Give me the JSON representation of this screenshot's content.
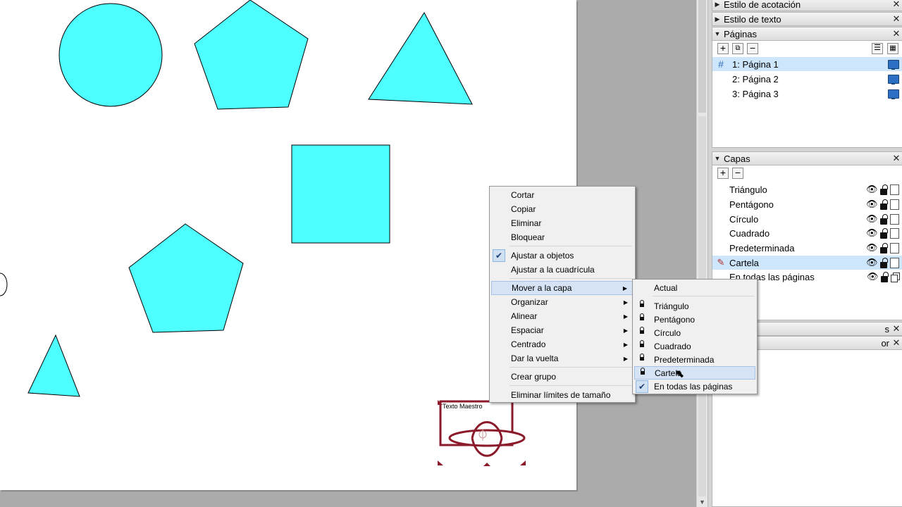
{
  "canvas": {
    "shape_fill": "#4dffff",
    "stamp_color": "#8b1a2b",
    "stamp_label": "Texto Maestro"
  },
  "panels": {
    "acotacion": {
      "title": "Estilo de acotación"
    },
    "texto": {
      "title": "Estilo de texto"
    },
    "paginas": {
      "title": "Páginas",
      "toolbar": [
        "add-icon",
        "duplicate-icon",
        "remove-icon",
        "list-view-icon",
        "grid-view-icon"
      ],
      "items": [
        {
          "label": "1:  Página 1",
          "selected": true
        },
        {
          "label": "2:  Página 2",
          "selected": false
        },
        {
          "label": "3:  Página 3",
          "selected": false
        }
      ]
    },
    "capas": {
      "title": "Capas",
      "items": [
        {
          "label": "Triángulo",
          "selected": false
        },
        {
          "label": "Pentágono",
          "selected": false
        },
        {
          "label": "Círculo",
          "selected": false
        },
        {
          "label": "Cuadrado",
          "selected": false
        },
        {
          "label": "Predeterminada",
          "selected": false
        },
        {
          "label": "Cartela",
          "selected": true
        },
        {
          "label": "En todas las páginas",
          "selected": false
        }
      ]
    },
    "collapsed1": {
      "title": "s"
    },
    "collapsed2": {
      "title": "or"
    }
  },
  "context_menu": {
    "items": [
      {
        "label": "Cortar"
      },
      {
        "label": "Copiar"
      },
      {
        "label": "Eliminar"
      },
      {
        "label": "Bloquear"
      },
      {
        "label": "Ajustar a objetos",
        "checked": true
      },
      {
        "label": "Ajustar a la cuadrícula"
      },
      {
        "label": "Mover a la capa",
        "submenu": true,
        "highlighted": true
      },
      {
        "label": "Organizar",
        "submenu": true
      },
      {
        "label": "Alinear",
        "submenu": true
      },
      {
        "label": "Espaciar",
        "submenu": true
      },
      {
        "label": "Centrado",
        "submenu": true
      },
      {
        "label": "Dar la vuelta",
        "submenu": true
      },
      {
        "label": "Crear grupo"
      },
      {
        "label": "Eliminar límites de tamaño"
      }
    ]
  },
  "submenu": {
    "current_label": "Actual",
    "items": [
      {
        "label": "Triángulo"
      },
      {
        "label": "Pentágono"
      },
      {
        "label": "Círculo"
      },
      {
        "label": "Cuadrado"
      },
      {
        "label": "Predeterminada"
      },
      {
        "label": "Cartela",
        "highlighted": true
      },
      {
        "label": "En todas las páginas",
        "checked": true
      }
    ]
  }
}
